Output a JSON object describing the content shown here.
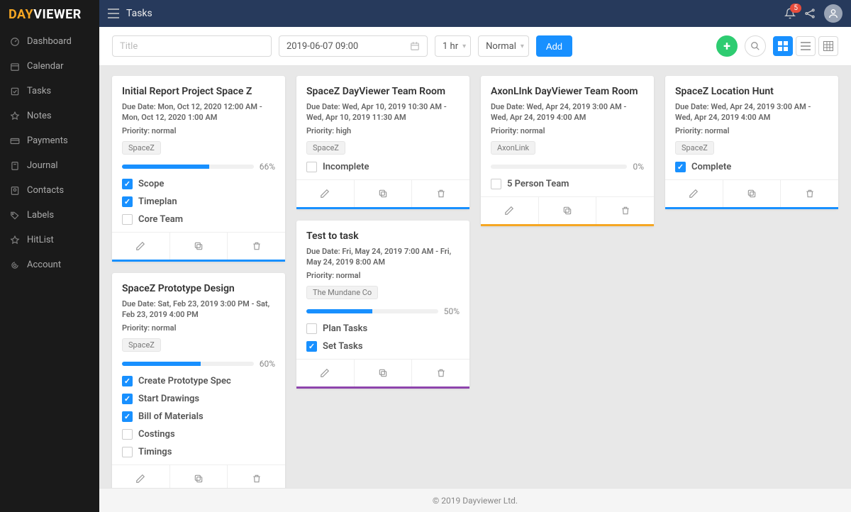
{
  "brand": {
    "part1": "DAY",
    "part2": "VIEWER"
  },
  "header": {
    "page_title": "Tasks",
    "notification_count": "5"
  },
  "sidebar": {
    "items": [
      {
        "label": "Dashboard",
        "icon": "dashboard-icon"
      },
      {
        "label": "Calendar",
        "icon": "calendar-icon"
      },
      {
        "label": "Tasks",
        "icon": "tasks-icon"
      },
      {
        "label": "Notes",
        "icon": "notes-icon"
      },
      {
        "label": "Payments",
        "icon": "payments-icon"
      },
      {
        "label": "Journal",
        "icon": "journal-icon"
      },
      {
        "label": "Contacts",
        "icon": "contacts-icon"
      },
      {
        "label": "Labels",
        "icon": "labels-icon"
      },
      {
        "label": "HitList",
        "icon": "hitlist-icon"
      },
      {
        "label": "Account",
        "icon": "account-icon"
      }
    ]
  },
  "toolbar": {
    "title_placeholder": "Title",
    "date_value": "2019-06-07 09:00",
    "duration": "1 hr",
    "priority": "Normal",
    "add_label": "Add"
  },
  "columns": [
    [
      {
        "title": "Initial Report Project Space Z",
        "due": "Due Date: Mon, Oct 12, 2020 12:00 AM - Mon, Oct 12, 2020 1:00 AM",
        "priority": "Priority: normal",
        "tag": "SpaceZ",
        "progress": 66,
        "pct_label": "66%",
        "border_color": "#1890ff",
        "items": [
          {
            "label": "Scope",
            "checked": true
          },
          {
            "label": "Timeplan",
            "checked": true
          },
          {
            "label": "Core Team",
            "checked": false
          }
        ]
      },
      {
        "title": "SpaceZ Prototype Design",
        "due": "Due Date: Sat, Feb 23, 2019 3:00 PM - Sat, Feb 23, 2019 4:00 PM",
        "priority": "Priority: normal",
        "tag": "SpaceZ",
        "progress": 60,
        "pct_label": "60%",
        "border_color": "#1890ff",
        "items": [
          {
            "label": "Create Prototype Spec",
            "checked": true
          },
          {
            "label": "Start Drawings",
            "checked": true
          },
          {
            "label": "Bill of Materials",
            "checked": true
          },
          {
            "label": "Costings",
            "checked": false
          },
          {
            "label": "Timings",
            "checked": false
          }
        ]
      }
    ],
    [
      {
        "title": "SpaceZ DayViewer Team Room",
        "due": "Due Date: Wed, Apr 10, 2019 10:30 AM - Wed, Apr 10, 2019 11:30 AM",
        "priority": "Priority: high",
        "tag": "SpaceZ",
        "progress": null,
        "pct_label": "",
        "border_color": "#1890ff",
        "items": [
          {
            "label": "Incomplete",
            "checked": false
          }
        ]
      },
      {
        "title": "Test to task",
        "due": "Due Date: Fri, May 24, 2019 7:00 AM - Fri, May 24, 2019 8:00 AM",
        "priority": "Priority: normal",
        "tag": "The Mundane Co",
        "progress": 50,
        "pct_label": "50%",
        "border_color": "#8e44ad",
        "items": [
          {
            "label": "Plan Tasks",
            "checked": false
          },
          {
            "label": "Set Tasks",
            "checked": true
          }
        ]
      }
    ],
    [
      {
        "title": "AxonLInk DayViewer Team Room",
        "due": "Due Date: Wed, Apr 24, 2019 3:00 AM - Wed, Apr 24, 2019 4:00 AM",
        "priority": "Priority: normal",
        "tag": "AxonLink",
        "progress": 0,
        "pct_label": "0%",
        "border_color": "#f5a623",
        "items": [
          {
            "label": "5 Person Team",
            "checked": false
          }
        ]
      }
    ],
    [
      {
        "title": "SpaceZ Location Hunt",
        "due": "Due Date: Wed, Apr 24, 2019 3:00 AM - Wed, Apr 24, 2019 4:00 AM",
        "priority": "Priority: normal",
        "tag": "SpaceZ",
        "progress": null,
        "pct_label": "",
        "border_color": "#1890ff",
        "items": [
          {
            "label": "Complete",
            "checked": true
          }
        ]
      }
    ]
  ],
  "footer": {
    "copyright": "© 2019 Dayviewer Ltd."
  },
  "icons": {
    "edit_title": "Edit",
    "copy_title": "Duplicate",
    "delete_title": "Delete"
  }
}
